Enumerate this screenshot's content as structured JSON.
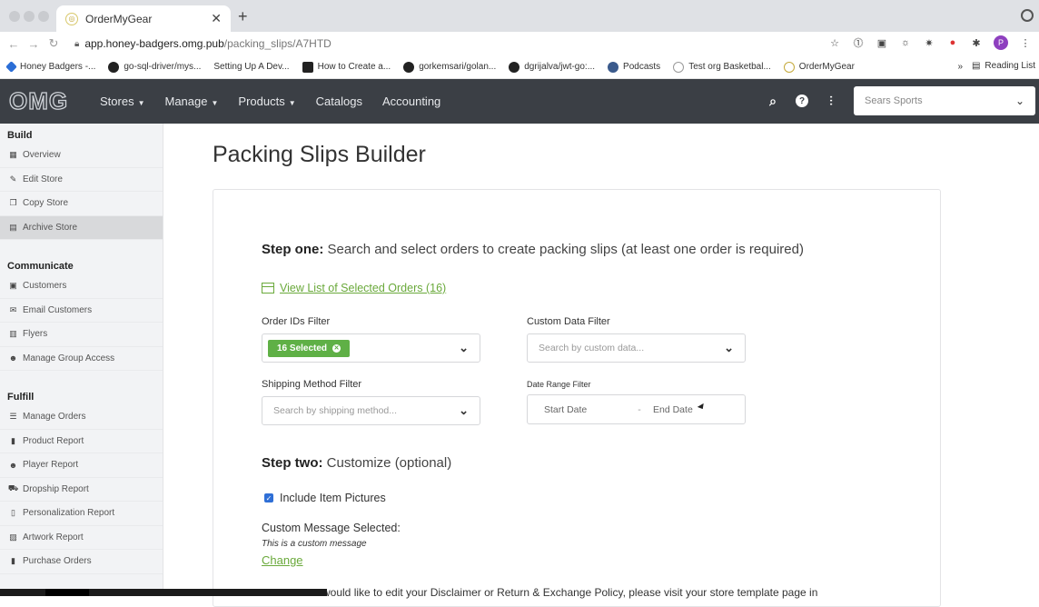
{
  "browser": {
    "tab_title": "OrderMyGear",
    "url_host": "app.honey-badgers.omg.pub",
    "url_path": "/packing_slips/A7HTD",
    "profile_initial": "P",
    "bookmarks": [
      {
        "label": "Honey Badgers -...",
        "icon": "diamond-icon"
      },
      {
        "label": "go-sql-driver/mys...",
        "icon": "github-icon"
      },
      {
        "label": "Setting Up A Dev...",
        "icon": "none"
      },
      {
        "label": "How to Create a...",
        "icon": "bookmark-square-icon"
      },
      {
        "label": "gorkemsari/golan...",
        "icon": "github-icon"
      },
      {
        "label": "dgrijalva/jwt-go:...",
        "icon": "github-icon"
      },
      {
        "label": "Podcasts",
        "icon": "podcast-icon"
      },
      {
        "label": "Test org Basketbal...",
        "icon": "ball-icon"
      },
      {
        "label": "OrderMyGear",
        "icon": "omg-icon"
      }
    ],
    "bookmarks_more": "»",
    "reading_list": "Reading List"
  },
  "header": {
    "logo": "OMG",
    "nav": [
      {
        "label": "Stores",
        "dropdown": true
      },
      {
        "label": "Manage",
        "dropdown": true
      },
      {
        "label": "Products",
        "dropdown": true
      },
      {
        "label": "Catalogs",
        "dropdown": false
      },
      {
        "label": "Accounting",
        "dropdown": false
      }
    ],
    "store_select": "Sears Sports"
  },
  "sidebar": {
    "sections": [
      {
        "title": "Build",
        "items": [
          {
            "label": "Overview",
            "icon": "grid-icon",
            "active": false
          },
          {
            "label": "Edit Store",
            "icon": "pencil-icon",
            "active": false
          },
          {
            "label": "Copy Store",
            "icon": "copy-icon",
            "active": false
          },
          {
            "label": "Archive Store",
            "icon": "archive-icon",
            "active": true
          }
        ]
      },
      {
        "title": "Communicate",
        "items": [
          {
            "label": "Customers",
            "icon": "user-card-icon",
            "active": false
          },
          {
            "label": "Email Customers",
            "icon": "envelope-icon",
            "active": false
          },
          {
            "label": "Flyers",
            "icon": "flyer-icon",
            "active": false
          },
          {
            "label": "Manage Group Access",
            "icon": "group-icon",
            "active": false
          }
        ]
      },
      {
        "title": "Fulfill",
        "items": [
          {
            "label": "Manage Orders",
            "icon": "list-icon",
            "active": false
          },
          {
            "label": "Product Report",
            "icon": "file-icon",
            "active": false
          },
          {
            "label": "Player Report",
            "icon": "group-icon",
            "active": false
          },
          {
            "label": "Dropship Report",
            "icon": "truck-icon",
            "active": false
          },
          {
            "label": "Personalization Report",
            "icon": "file-icon",
            "active": false
          },
          {
            "label": "Artwork Report",
            "icon": "image-icon",
            "active": false
          },
          {
            "label": "Purchase Orders",
            "icon": "file-icon",
            "active": false
          }
        ]
      }
    ]
  },
  "main": {
    "page_title": "Packing Slips Builder",
    "step_one_bold": "Step one:",
    "step_one_text": " Search and select orders to create packing slips (at least one order is required)",
    "view_selected_link": "View List of Selected Orders (16)",
    "order_ids_label": "Order IDs Filter",
    "order_ids_chip": "16 Selected",
    "custom_data_label": "Custom Data Filter",
    "custom_data_placeholder": "Search by custom data...",
    "shipping_label": "Shipping Method Filter",
    "shipping_placeholder": "Search by shipping method...",
    "date_range_label": "Date Range Filter",
    "start_date": "Start Date",
    "date_sep": "-",
    "end_date": "End Date",
    "step_two_bold": "Step two:",
    "step_two_text": " Customize (optional)",
    "include_pictures_label": "Include Item Pictures",
    "include_pictures_checked": true,
    "custom_message_label": "Custom Message Selected:",
    "custom_message_value": "This is a custom message",
    "change_link": "Change",
    "disclaimer_partial": "would like to edit your Disclaimer or Return & Exchange Policy, please visit your store template page in"
  },
  "colors": {
    "nav_bg": "#3b3f45",
    "accent_green": "#5fb046",
    "link_green": "#6aa93b",
    "checkbox_blue": "#2f6fd6"
  }
}
